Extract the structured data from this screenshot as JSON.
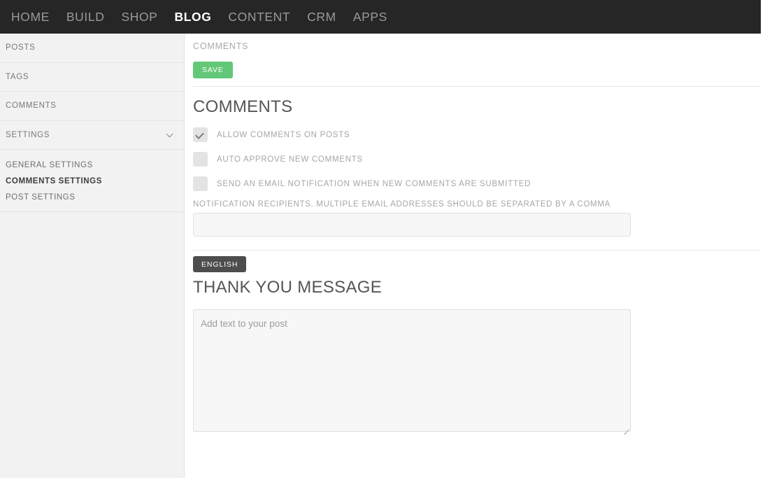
{
  "topnav": {
    "items": [
      {
        "label": "HOME",
        "active": false
      },
      {
        "label": "BUILD",
        "active": false
      },
      {
        "label": "SHOP",
        "active": false
      },
      {
        "label": "BLOG",
        "active": true
      },
      {
        "label": "CONTENT",
        "active": false
      },
      {
        "label": "CRM",
        "active": false
      },
      {
        "label": "APPS",
        "active": false
      }
    ],
    "background_color": "#262626",
    "active_color": "#ffffff",
    "inactive_color": "#9a9a9a"
  },
  "sidebar": {
    "items": [
      {
        "label": "POSTS",
        "has_chevron": false
      },
      {
        "label": "TAGS",
        "has_chevron": false
      },
      {
        "label": "COMMENTS",
        "has_chevron": false
      },
      {
        "label": "SETTINGS",
        "has_chevron": true,
        "chevron_icon": "chevron-down-icon"
      }
    ],
    "sub_items": [
      {
        "label": "GENERAL SETTINGS",
        "active": false
      },
      {
        "label": "COMMENTS SETTINGS",
        "active": true
      },
      {
        "label": "POST SETTINGS",
        "active": false
      }
    ],
    "background_color": "#f2f2f2"
  },
  "main": {
    "breadcrumb": "COMMENTS",
    "save_label": "SAVE",
    "save_color": "#62c877",
    "comments_section_title": "COMMENTS",
    "checkboxes": [
      {
        "label": "ALLOW COMMENTS ON POSTS",
        "checked": true
      },
      {
        "label": "AUTO APPROVE NEW COMMENTS",
        "checked": false
      },
      {
        "label": "SEND AN EMAIL NOTIFICATION WHEN NEW COMMENTS ARE SUBMITTED",
        "checked": false
      }
    ],
    "recipients_label": "NOTIFICATION RECIPIENTS. MULTIPLE EMAIL ADDRESSES SHOULD BE SEPARATED BY A COMMA",
    "recipients_value": "",
    "recipients_placeholder": "",
    "language_label": "ENGLISH",
    "language_color": "#4d4d4d",
    "thankyou_section_title": "THANK YOU MESSAGE",
    "thankyou_value": "",
    "thankyou_placeholder": "Add text to your post"
  }
}
